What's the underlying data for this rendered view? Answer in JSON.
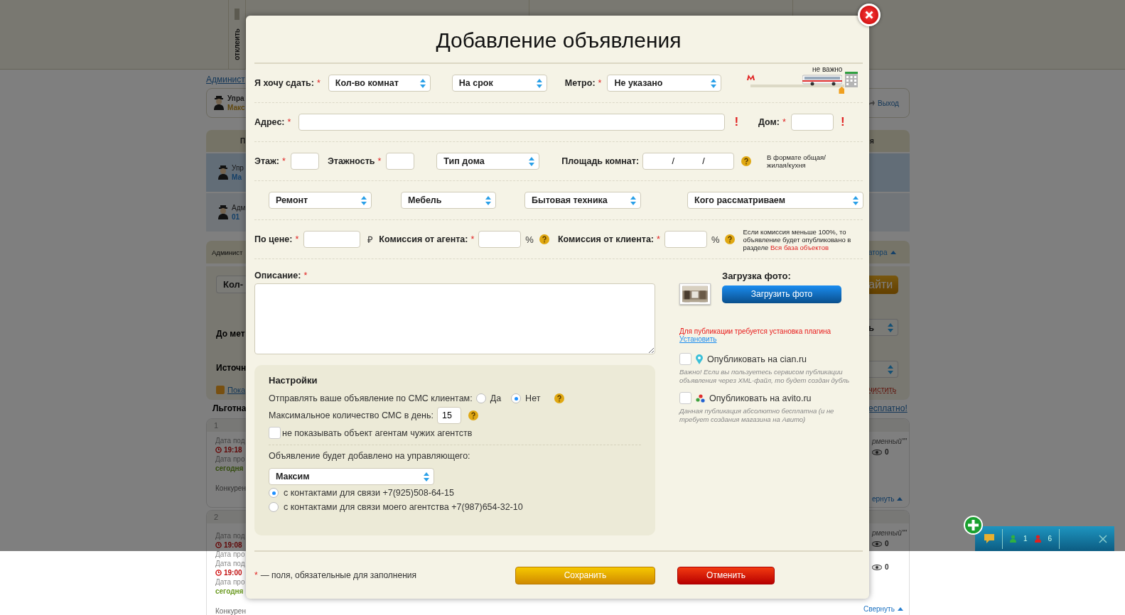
{
  "background": {
    "top_bar": {
      "vertical_label": "отклеить"
    },
    "link_row": {
      "text": "Админист"
    },
    "user_card": {
      "name": "Упра",
      "sub": "Макс",
      "logout": "Выход"
    },
    "tab_row": {
      "left": "П",
      "right": "я"
    },
    "user_rows": [
      {
        "role": "Упр",
        "name": "Ма",
        "selected": true
      },
      {
        "role": "Адм",
        "name": "01",
        "selected": false
      }
    ],
    "section_bar": {
      "left": "Админист",
      "right": "атора"
    },
    "filter": {
      "select": "Кол-",
      "label_1": "До мет",
      "label_2": "Источн",
      "checkbox": {
        "label": "Пока",
        "checked": true
      },
      "search_button": "айти",
      "select_right": "ь",
      "clear_link": "чистить"
    },
    "heading": {
      "left": "Льготна",
      "right": "есплатно!"
    },
    "listings": [
      {
        "number": "1",
        "lines": [
          {
            "kind": "label",
            "text": "Дата под"
          },
          {
            "kind": "time",
            "text": "19:18"
          },
          {
            "kind": "label",
            "text": "Дата про"
          },
          {
            "kind": "today",
            "text": "сегодня"
          },
          {
            "kind": "competitors",
            "text": "Конкурен"
          }
        ],
        "right": [
          {
            "kind": "italic",
            "text": "рменный\"\""
          },
          {
            "kind": "views",
            "text": "0"
          },
          {
            "kind": "collapse",
            "text": "ернуть"
          }
        ]
      },
      {
        "number": "2",
        "lines": [
          {
            "kind": "label",
            "text": "Дата под"
          },
          {
            "kind": "time",
            "text": "19:08"
          },
          {
            "kind": "label",
            "text": "Дата про"
          },
          {
            "kind": "label",
            "text": "Дата под"
          },
          {
            "kind": "time",
            "text": "19:00"
          },
          {
            "kind": "label",
            "text": "Дата про"
          },
          {
            "kind": "today",
            "text": "сегодня"
          },
          {
            "kind": "competitors",
            "text": "Конкурен"
          }
        ],
        "right": [
          {
            "kind": "italic",
            "text": "рменный\"\""
          },
          {
            "kind": "views",
            "text": "0"
          },
          {
            "kind": "views",
            "text": "0"
          },
          {
            "kind": "collapse",
            "text": "Свернуть"
          }
        ]
      }
    ],
    "chat": {
      "online": "1",
      "offline": "6"
    }
  },
  "dialog": {
    "title": "Добавление объявления",
    "rent": {
      "label": "Я хочу сдать:",
      "mark": "*",
      "rooms": "Кол-во комнат",
      "term": "На срок"
    },
    "metro": {
      "label": "Метро:",
      "mark": "*",
      "value": "Не указано",
      "distance_label": "не важно",
      "level": 1
    },
    "address": {
      "label": "Адрес:",
      "mark": "*",
      "warning": "!",
      "house_label": "Дом:",
      "house_mark": "*",
      "house_warning": "!"
    },
    "floors": {
      "floor_label": "Этаж:",
      "floor_mark": "*",
      "floors_label": "Этажность",
      "floors_mark": "*",
      "house_type": "Тип дома",
      "area_label": "Площадь комнат:",
      "area_value": "/ /",
      "area_hint": "В формате общая/жилая/кухня"
    },
    "selects": [
      "Ремонт",
      "Мебель",
      "Бытовая техника",
      "Кого рассматриваем"
    ],
    "price": {
      "label": "По цене:",
      "mark": "*",
      "currency": "₽",
      "agent_label": "Комиссия от агента:",
      "agent_mark": "*",
      "agent_percent": "%",
      "client_label": "Комиссия от клиента:",
      "client_mark": "*",
      "client_percent": "%",
      "note": "Если комиссия меньше 100%, то объявление будет опубликовано в разделе",
      "note_link": "Вся база объектов"
    },
    "description": {
      "label": "Описание:",
      "mark": "*"
    },
    "settings": {
      "title": "Настройки",
      "sms_label": "Отправлять ваше объявление по СМС клиентам:",
      "sms_options": [
        {
          "label": "Да",
          "selected": false
        },
        {
          "label": "Нет",
          "selected": true
        }
      ],
      "max_sms_label": "Максимальное количество СМС в день:",
      "max_sms_value": "15",
      "hide_checkbox": {
        "label": "не показывать объект агентам чужих агентств",
        "checked": false
      },
      "manager_label": "Объявление будет добавлено на управляющего:",
      "manager": "Максим",
      "contact_options": [
        {
          "label": "с контактами для связи +7(925)508-64-15",
          "selected": true
        },
        {
          "label": "с контактами для связи моего агентства +7(987)654-32-10",
          "selected": false
        }
      ]
    },
    "photo": {
      "title": "Загрузка фото:",
      "button": "Загрузить фото",
      "plugin_warning": "Для публикации требуется установка плагина",
      "install_link": "Установить",
      "publish": [
        {
          "kind": "pin",
          "label": "Опубликовать на cian.ru",
          "checked": false,
          "note": "Важно! Если вы пользуетесь сервисом публикации объявления через XML-файл, то будет создан дубль"
        },
        {
          "kind": "dots",
          "label": "Опубликовать на avito.ru",
          "checked": false,
          "note": "Данная публикация абсолютно бесплатна (и не требует создания магазина на Авито)"
        }
      ]
    },
    "footer": {
      "mark": "*",
      "note": "— поля, обязательные для заполнения",
      "save": "Сохранить",
      "cancel": "Отменить"
    }
  }
}
